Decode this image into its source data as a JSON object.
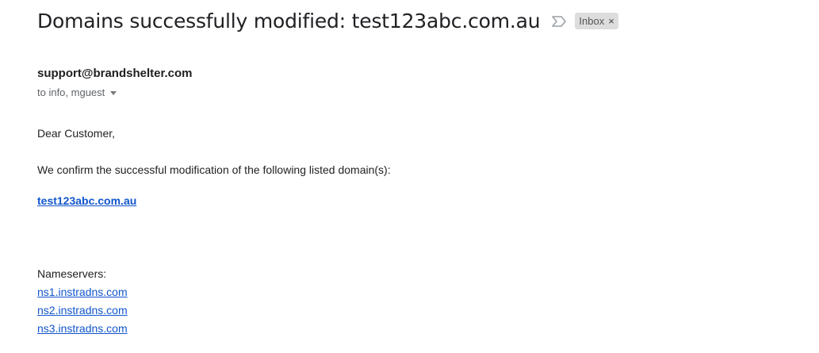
{
  "email": {
    "subject": "Domains successfully modified: test123abc.com.au",
    "label": "Inbox",
    "label_close_glyph": "×",
    "importance_icon": "importance-marker-icon",
    "sender": "support@brandshelter.com",
    "recipients": "to info, mguest",
    "body": {
      "greeting": "Dear Customer,",
      "confirmation": "We confirm the successful modification of the following listed domain(s):",
      "domain": "test123abc.com.au",
      "nameservers_heading": "Nameservers:",
      "nameservers": [
        "ns1.instradns.com",
        "ns2.instradns.com",
        "ns3.instradns.com"
      ]
    }
  },
  "colors": {
    "link": "#1155cc",
    "label_chip_bg": "#dddddd",
    "secondary_text": "#5f6368"
  }
}
